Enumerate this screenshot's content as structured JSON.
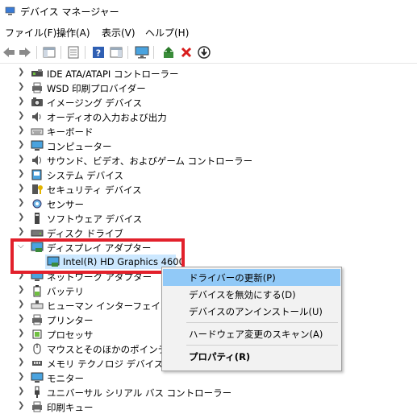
{
  "window": {
    "title": "デバイス マネージャー"
  },
  "menu": [
    "ファイル(F)",
    "操作(A)",
    "表示(V)",
    "ヘルプ(H)"
  ],
  "toolbar": [
    "back-arrow-icon",
    "forward-arrow-icon",
    "show-hide-console-tree-icon",
    "properties-icon",
    "help-icon",
    "show-action-pane-icon",
    "monitor-icon",
    "update-driver-icon",
    "uninstall-icon",
    "download-icon"
  ],
  "tree": {
    "items": [
      {
        "label": "IDE ATA/ATAPI コントローラー",
        "icon": "ide-controller-icon"
      },
      {
        "label": "WSD 印刷プロバイダー",
        "icon": "wsd-printer-icon"
      },
      {
        "label": "イメージング デバイス",
        "icon": "imaging-device-icon"
      },
      {
        "label": "オーディオの入力および出力",
        "icon": "speaker-icon"
      },
      {
        "label": "キーボード",
        "icon": "keyboard-icon"
      },
      {
        "label": "コンピューター",
        "icon": "computer-icon"
      },
      {
        "label": "サウンド、ビデオ、およびゲーム コントローラー",
        "icon": "sound-icon"
      },
      {
        "label": "システム デバイス",
        "icon": "system-device-icon"
      },
      {
        "label": "セキュリティ デバイス",
        "icon": "security-device-icon"
      },
      {
        "label": "センサー",
        "icon": "sensor-icon"
      },
      {
        "label": "ソフトウェア デバイス",
        "icon": "software-device-icon"
      },
      {
        "label": "ディスク ドライブ",
        "icon": "disk-drive-icon"
      },
      {
        "label": "ディスプレイ アダプター",
        "icon": "display-adapter-icon",
        "expanded": true
      },
      {
        "label": "Intel(R) HD Graphics 4600",
        "icon": "display-adapter-icon",
        "child": true,
        "selected": true
      },
      {
        "label": "ネットワーク アダプター",
        "icon": "network-adapter-icon"
      },
      {
        "label": "バッテリ",
        "icon": "battery-icon"
      },
      {
        "label": "ヒューマン インターフェイス デバイス",
        "icon": "hid-icon"
      },
      {
        "label": "プリンター",
        "icon": "printer-icon"
      },
      {
        "label": "プロセッサ",
        "icon": "processor-icon"
      },
      {
        "label": "マウスとそのほかのポインティング デバイス",
        "icon": "mouse-icon"
      },
      {
        "label": "メモリ テクノロジ デバイス",
        "icon": "memory-icon"
      },
      {
        "label": "モニター",
        "icon": "monitor-icon"
      },
      {
        "label": "ユニバーサル シリアル バス コントローラー",
        "icon": "usb-icon"
      },
      {
        "label": "印刷キュー",
        "icon": "print-queue-icon"
      }
    ]
  },
  "context_menu": {
    "items": [
      {
        "label": "ドライバーの更新(P)",
        "active": true
      },
      {
        "label": "デバイスを無効にする(D)"
      },
      {
        "label": "デバイスのアンインストール(U)"
      },
      {
        "label": "ハードウェア変更のスキャン(A)"
      },
      {
        "label": "プロパティ(R)",
        "bold": true
      }
    ]
  },
  "colors": {
    "highlight_border": "#e2202b",
    "menu_active": "#91c9f7",
    "selection": "#cce8ff"
  }
}
